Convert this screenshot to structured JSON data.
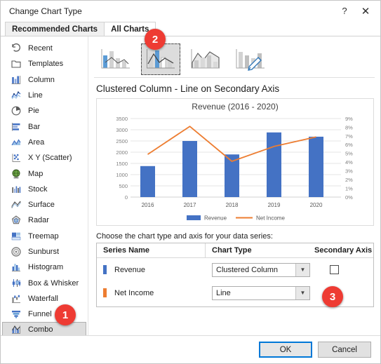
{
  "window": {
    "title": "Change Chart Type",
    "help_label": "?",
    "close_label": "✕"
  },
  "tabs": [
    {
      "label": "Recommended Charts",
      "active": false
    },
    {
      "label": "All Charts",
      "active": true
    }
  ],
  "sidebar": {
    "items": [
      {
        "label": "Recent",
        "icon": "recent-icon",
        "selected": false
      },
      {
        "label": "Templates",
        "icon": "templates-icon",
        "selected": false
      },
      {
        "label": "Column",
        "icon": "column-icon",
        "selected": false
      },
      {
        "label": "Line",
        "icon": "line-icon",
        "selected": false
      },
      {
        "label": "Pie",
        "icon": "pie-icon",
        "selected": false
      },
      {
        "label": "Bar",
        "icon": "bar-icon",
        "selected": false
      },
      {
        "label": "Area",
        "icon": "area-icon",
        "selected": false
      },
      {
        "label": "X Y (Scatter)",
        "icon": "scatter-icon",
        "selected": false
      },
      {
        "label": "Map",
        "icon": "map-icon",
        "selected": false
      },
      {
        "label": "Stock",
        "icon": "stock-icon",
        "selected": false
      },
      {
        "label": "Surface",
        "icon": "surface-icon",
        "selected": false
      },
      {
        "label": "Radar",
        "icon": "radar-icon",
        "selected": false
      },
      {
        "label": "Treemap",
        "icon": "treemap-icon",
        "selected": false
      },
      {
        "label": "Sunburst",
        "icon": "sunburst-icon",
        "selected": false
      },
      {
        "label": "Histogram",
        "icon": "histogram-icon",
        "selected": false
      },
      {
        "label": "Box & Whisker",
        "icon": "box-whisker-icon",
        "selected": false
      },
      {
        "label": "Waterfall",
        "icon": "waterfall-icon",
        "selected": false
      },
      {
        "label": "Funnel",
        "icon": "funnel-icon",
        "selected": false
      },
      {
        "label": "Combo",
        "icon": "combo-icon",
        "selected": true
      }
    ]
  },
  "thumbnails": [
    {
      "name": "clustered-column-line",
      "selected": false
    },
    {
      "name": "clustered-column-line-secondary",
      "selected": true
    },
    {
      "name": "stacked-area-clustered-column",
      "selected": false
    },
    {
      "name": "custom-combination",
      "selected": false
    }
  ],
  "preview": {
    "variant_title": "Clustered Column - Line on Secondary Axis"
  },
  "series_section": {
    "caption": "Choose the chart type and axis for your data series:",
    "headers": {
      "series_name": "Series Name",
      "chart_type": "Chart Type",
      "secondary_axis": "Secondary Axis"
    },
    "rows": [
      {
        "name": "Revenue",
        "color": "#4472C4",
        "chart_type": "Clustered Column",
        "secondary_axis": false
      },
      {
        "name": "Net Income",
        "color": "#ED7D31",
        "chart_type": "Line",
        "secondary_axis": true
      }
    ]
  },
  "footer": {
    "ok_label": "OK",
    "cancel_label": "Cancel"
  },
  "badges": [
    {
      "id": "badge1",
      "label": "1",
      "color": "#EE3B33"
    },
    {
      "id": "badge2",
      "label": "2",
      "color": "#EE3B33"
    },
    {
      "id": "badge3",
      "label": "3",
      "color": "#EE3B33"
    }
  ],
  "chart_data": {
    "type": "bar",
    "title": "Revenue (2016 - 2020)",
    "xlabel": "",
    "ylabel": "",
    "categories": [
      "2016",
      "2017",
      "2018",
      "2019",
      "2020"
    ],
    "series": [
      {
        "name": "Revenue",
        "type": "bar",
        "axis": "primary",
        "color": "#4472C4",
        "values": [
          1380,
          2500,
          1900,
          2880,
          2690
        ]
      },
      {
        "name": "Net Income",
        "type": "line",
        "axis": "secondary",
        "color": "#ED7D31",
        "values": [
          4.9,
          8.1,
          4.1,
          5.8,
          6.9
        ]
      }
    ],
    "ylim": [
      0,
      3500
    ],
    "ytick_labels": [
      "0",
      "500",
      "1000",
      "1500",
      "2000",
      "2500",
      "3000",
      "3500"
    ],
    "y2lim": [
      0,
      9
    ],
    "y2tick_labels": [
      "0%",
      "1%",
      "2%",
      "3%",
      "4%",
      "5%",
      "6%",
      "7%",
      "8%",
      "9%"
    ],
    "grid": true,
    "legend": [
      "Revenue",
      "Net Income"
    ],
    "legend_position": "bottom"
  }
}
